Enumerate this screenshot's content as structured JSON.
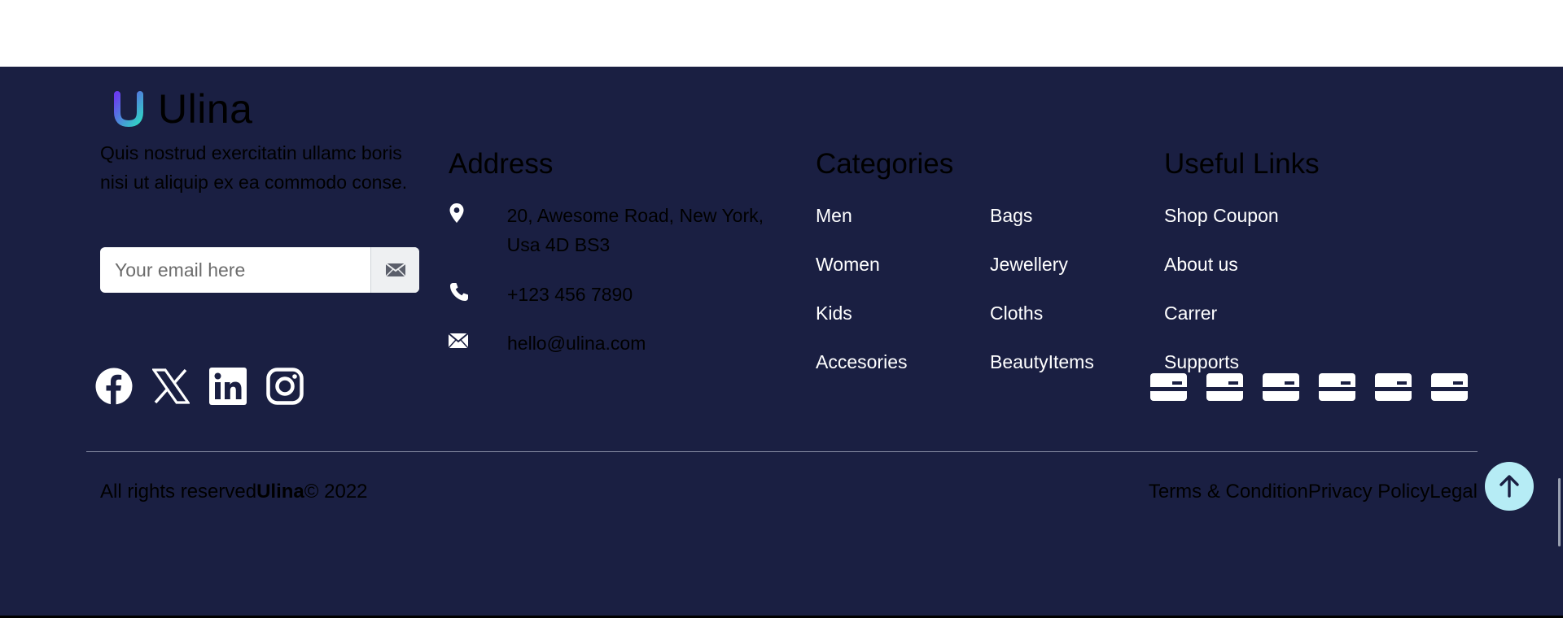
{
  "brand": {
    "name": "Ulina",
    "description": "Quis nostrud exercitatin ullamc boris nisi ut aliquip ex ea commodo conse."
  },
  "newsletter": {
    "placeholder": "Your email here",
    "send_icon": "envelope-icon"
  },
  "address": {
    "title": "Address",
    "street": "20, Awesome Road, New York, Usa 4D BS3",
    "phone": "+123 456 7890",
    "email": "hello@ulina.com"
  },
  "categories": {
    "title": "Categories",
    "col1": [
      "Men",
      "Women",
      "Kids",
      "Accesories"
    ],
    "col2": [
      "Bags",
      "Jewellery",
      "Cloths",
      "BeautyItems"
    ]
  },
  "useful_links": {
    "title": "Useful Links",
    "items": [
      "Shop Coupon",
      "About us",
      "Carrer",
      "Supports"
    ]
  },
  "social": [
    "facebook-icon",
    "x-twitter-icon",
    "linkedin-icon",
    "instagram-icon"
  ],
  "payments": [
    "card-icon",
    "card-icon",
    "card-icon",
    "card-icon",
    "card-icon",
    "card-icon"
  ],
  "footer_bottom": {
    "copyright_prefix": "All rights reserved",
    "copyright_brand": "Ulina",
    "copyright_suffix": "© 2022",
    "legal": [
      "Terms & Condition",
      "Privacy Policy",
      "Legal"
    ]
  },
  "colors": {
    "background": "#1a1f42",
    "scroll_top": "#b6ecf5",
    "logo_gradient_start": "#6a3df0",
    "logo_gradient_end": "#2fd6c4"
  }
}
